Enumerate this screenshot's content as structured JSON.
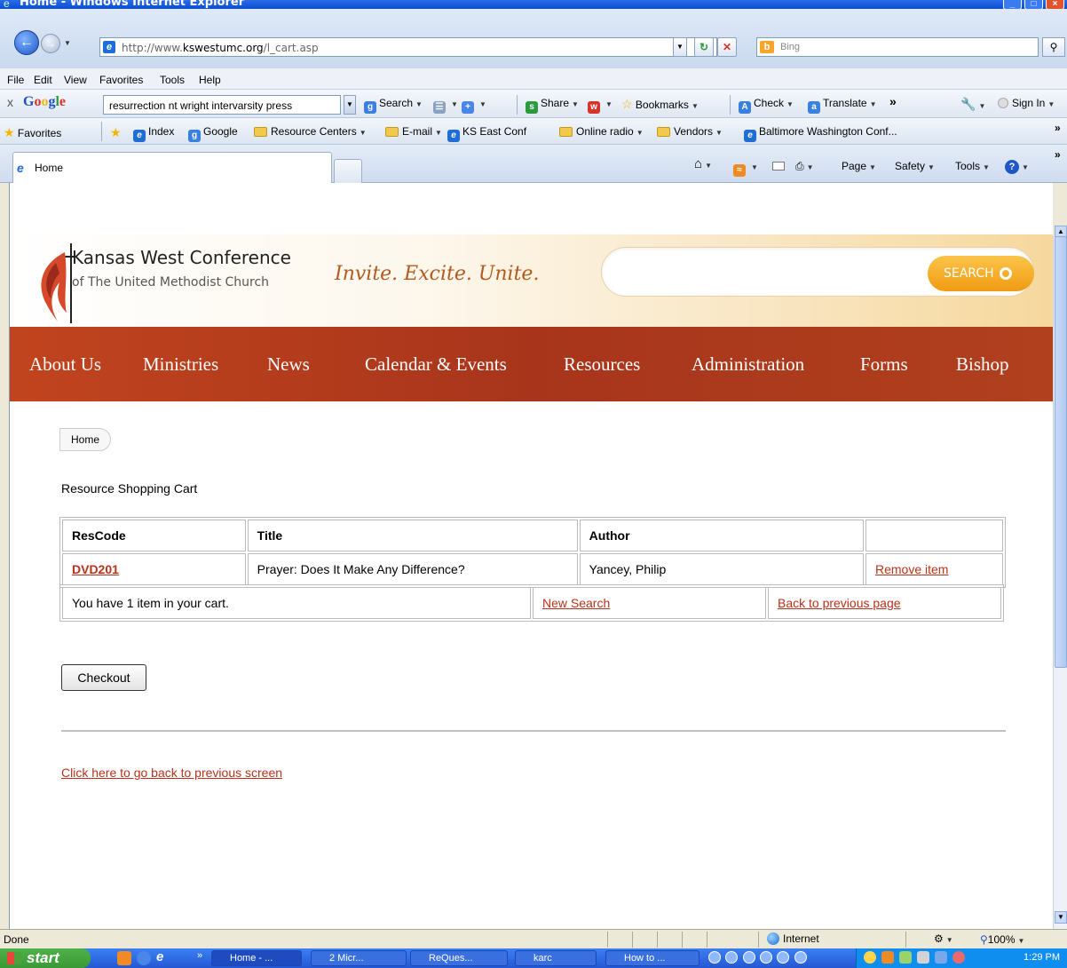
{
  "window": {
    "title": "Home - Windows Internet Explorer"
  },
  "addressbar": {
    "url_prefix": "http://www.",
    "url_domain": "kswestumc.org",
    "url_path": "/l_cart.asp",
    "search_provider": "Bing"
  },
  "menubar": {
    "items": [
      "File",
      "Edit",
      "View",
      "Favorites",
      "Tools",
      "Help"
    ]
  },
  "google_toolbar": {
    "close": "x",
    "logo": "Google",
    "query": "resurrection nt wright intervarsity press",
    "search": "Search",
    "share": "Share",
    "bookmarks": "Bookmarks",
    "check": "Check",
    "translate": "Translate",
    "more": "»",
    "signin": "Sign In"
  },
  "favorites_bar": {
    "favorites": "Favorites",
    "items": [
      "Index",
      "Google",
      "Resource Centers",
      "E-mail",
      "KS East Conf",
      "Online radio",
      "Vendors",
      "Baltimore Washington Conf..."
    ],
    "more": "»"
  },
  "tabs": {
    "active": "Home"
  },
  "command_bar": {
    "page": "Page",
    "safety": "Safety",
    "tools": "Tools"
  },
  "site": {
    "org_name": "Kansas West Conference",
    "org_sub": "of The United Methodist Church",
    "tagline": "Invite. Excite. Unite.",
    "search_button": "SEARCH",
    "nav": [
      "About Us",
      "Ministries",
      "News",
      "Calendar & Events",
      "Resources",
      "Administration",
      "Forms",
      "Bishop"
    ],
    "accent": "#b8321a"
  },
  "page": {
    "breadcrumb": "Home",
    "title": "Resource Shopping Cart",
    "cart": {
      "headers": [
        "ResCode",
        "Title",
        "Author",
        ""
      ],
      "rows": [
        {
          "code": "DVD201",
          "title": "Prayer: Does It Make Any Difference?",
          "author": "Yancey, Philip",
          "action": "Remove item"
        }
      ]
    },
    "summary": {
      "message": "You have 1 item in your cart.",
      "new_search": "New Search",
      "back": "Back to previous page"
    },
    "checkout": "Checkout",
    "back_link": "Click here to go back to previous screen"
  },
  "statusbar": {
    "status": "Done",
    "zone": "Internet",
    "zoom": "100%"
  },
  "taskbar": {
    "start": "start",
    "tasks": [
      "Home - ...",
      "2 Micr...",
      "ReQues...",
      "karc",
      "How to ..."
    ],
    "clock": "1:29 PM"
  }
}
